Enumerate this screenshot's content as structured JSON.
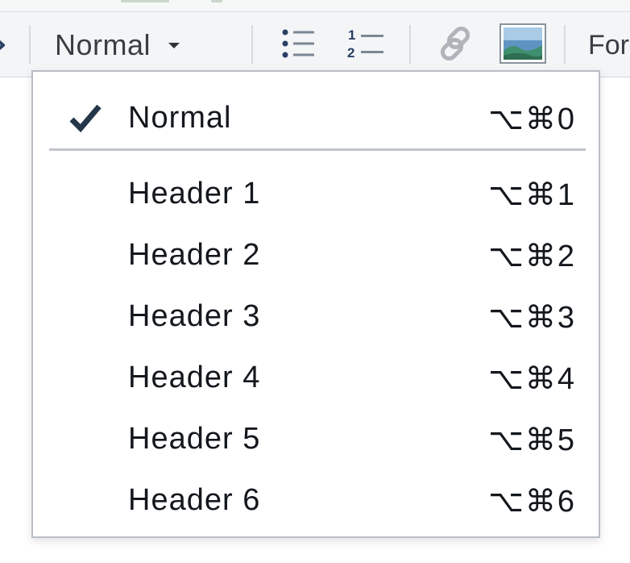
{
  "toolbar": {
    "style_value": "Normal",
    "format_label": "For"
  },
  "icons": {
    "left": "chevron-right-icon",
    "caret": "caret-down-icon",
    "bullet": "bulleted-list-icon",
    "numbered": "numbered-list-icon",
    "link": "link-icon",
    "image": "image-icon"
  },
  "dropdown": {
    "selected": "Normal",
    "items": [
      {
        "label": "Normal",
        "shortcut": "⌥⌘0"
      },
      {
        "label": "Header 1",
        "shortcut": "⌥⌘1"
      },
      {
        "label": "Header 2",
        "shortcut": "⌥⌘2"
      },
      {
        "label": "Header 3",
        "shortcut": "⌥⌘3"
      },
      {
        "label": "Header 4",
        "shortcut": "⌥⌘4"
      },
      {
        "label": "Header 5",
        "shortcut": "⌥⌘5"
      },
      {
        "label": "Header 6",
        "shortcut": "⌥⌘6"
      }
    ]
  },
  "colors": {
    "icon_blue": "#2b3f63",
    "checkmark": "#25364a",
    "link_gray": "#b0b4ba"
  }
}
